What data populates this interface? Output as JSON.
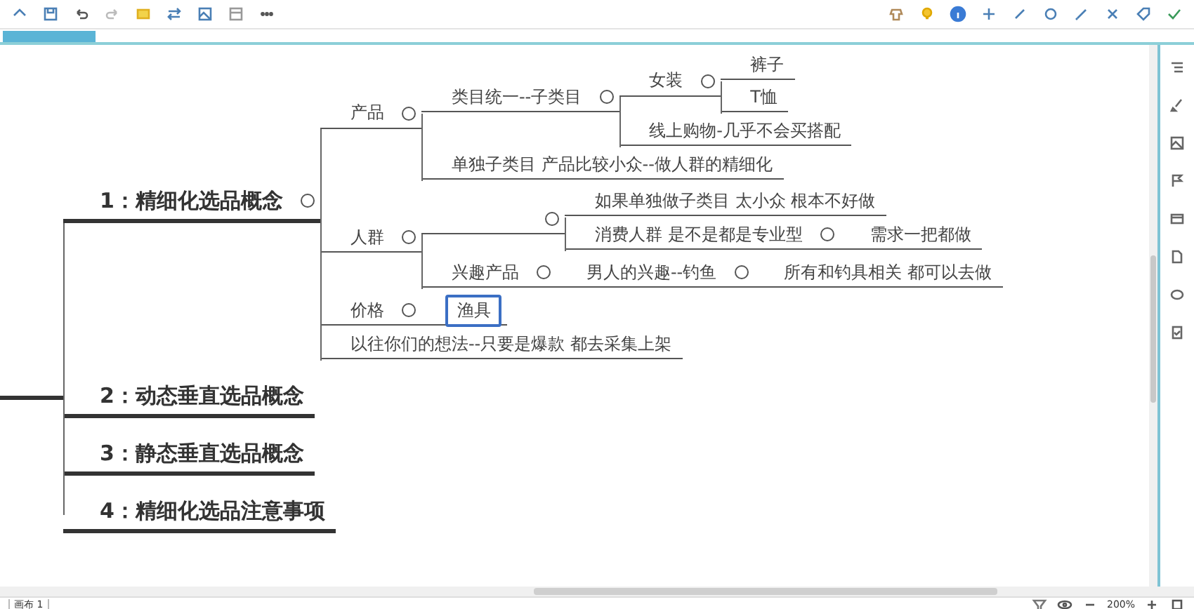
{
  "mind_map": {
    "topics": [
      {
        "label": "1：精细化选品概念",
        "selected": false,
        "children": [
          {
            "label": "产品",
            "selected": false,
            "children": [
              {
                "label": "类目统一--子类目",
                "selected": false,
                "children": [
                  {
                    "label": "女装",
                    "selected": false,
                    "children": [
                      {
                        "label": "裤子",
                        "selected": false
                      },
                      {
                        "label": "T恤",
                        "selected": false
                      }
                    ]
                  },
                  {
                    "label": "线上购物-几乎不会买搭配",
                    "selected": false
                  }
                ]
              },
              {
                "label": "单独子类目 产品比较小众--做人群的精细化",
                "selected": false
              }
            ]
          },
          {
            "label": "人群",
            "selected": false,
            "children": [
              {
                "children": [
                  {
                    "label": "如果单独做子类目 太小众 根本不好做",
                    "selected": false
                  },
                  {
                    "label": "消费人群 是不是都是专业型",
                    "selected": false,
                    "children": [
                      {
                        "label": "需求一把都做",
                        "selected": false
                      }
                    ]
                  }
                ]
              },
              {
                "label": "兴趣产品",
                "selected": false,
                "children": [
                  {
                    "label": "男人的兴趣--钓鱼",
                    "selected": false,
                    "children": [
                      {
                        "label": "所有和钓具相关 都可以去做",
                        "selected": false
                      }
                    ]
                  }
                ]
              }
            ]
          },
          {
            "label": "价格",
            "selected": false,
            "children": [
              {
                "label": "渔具",
                "selected": true
              }
            ]
          },
          {
            "label": "以往你们的想法--只要是爆款 都去采集上架",
            "selected": false
          }
        ]
      },
      {
        "label": "2：动态垂直选品概念",
        "selected": false
      },
      {
        "label": "3：静态垂直选品概念",
        "selected": false
      },
      {
        "label": "4：精细化选品注意事项",
        "selected": false
      }
    ]
  },
  "status_bar": {
    "sheet_tab": "画布 1",
    "zoom": "200%"
  }
}
